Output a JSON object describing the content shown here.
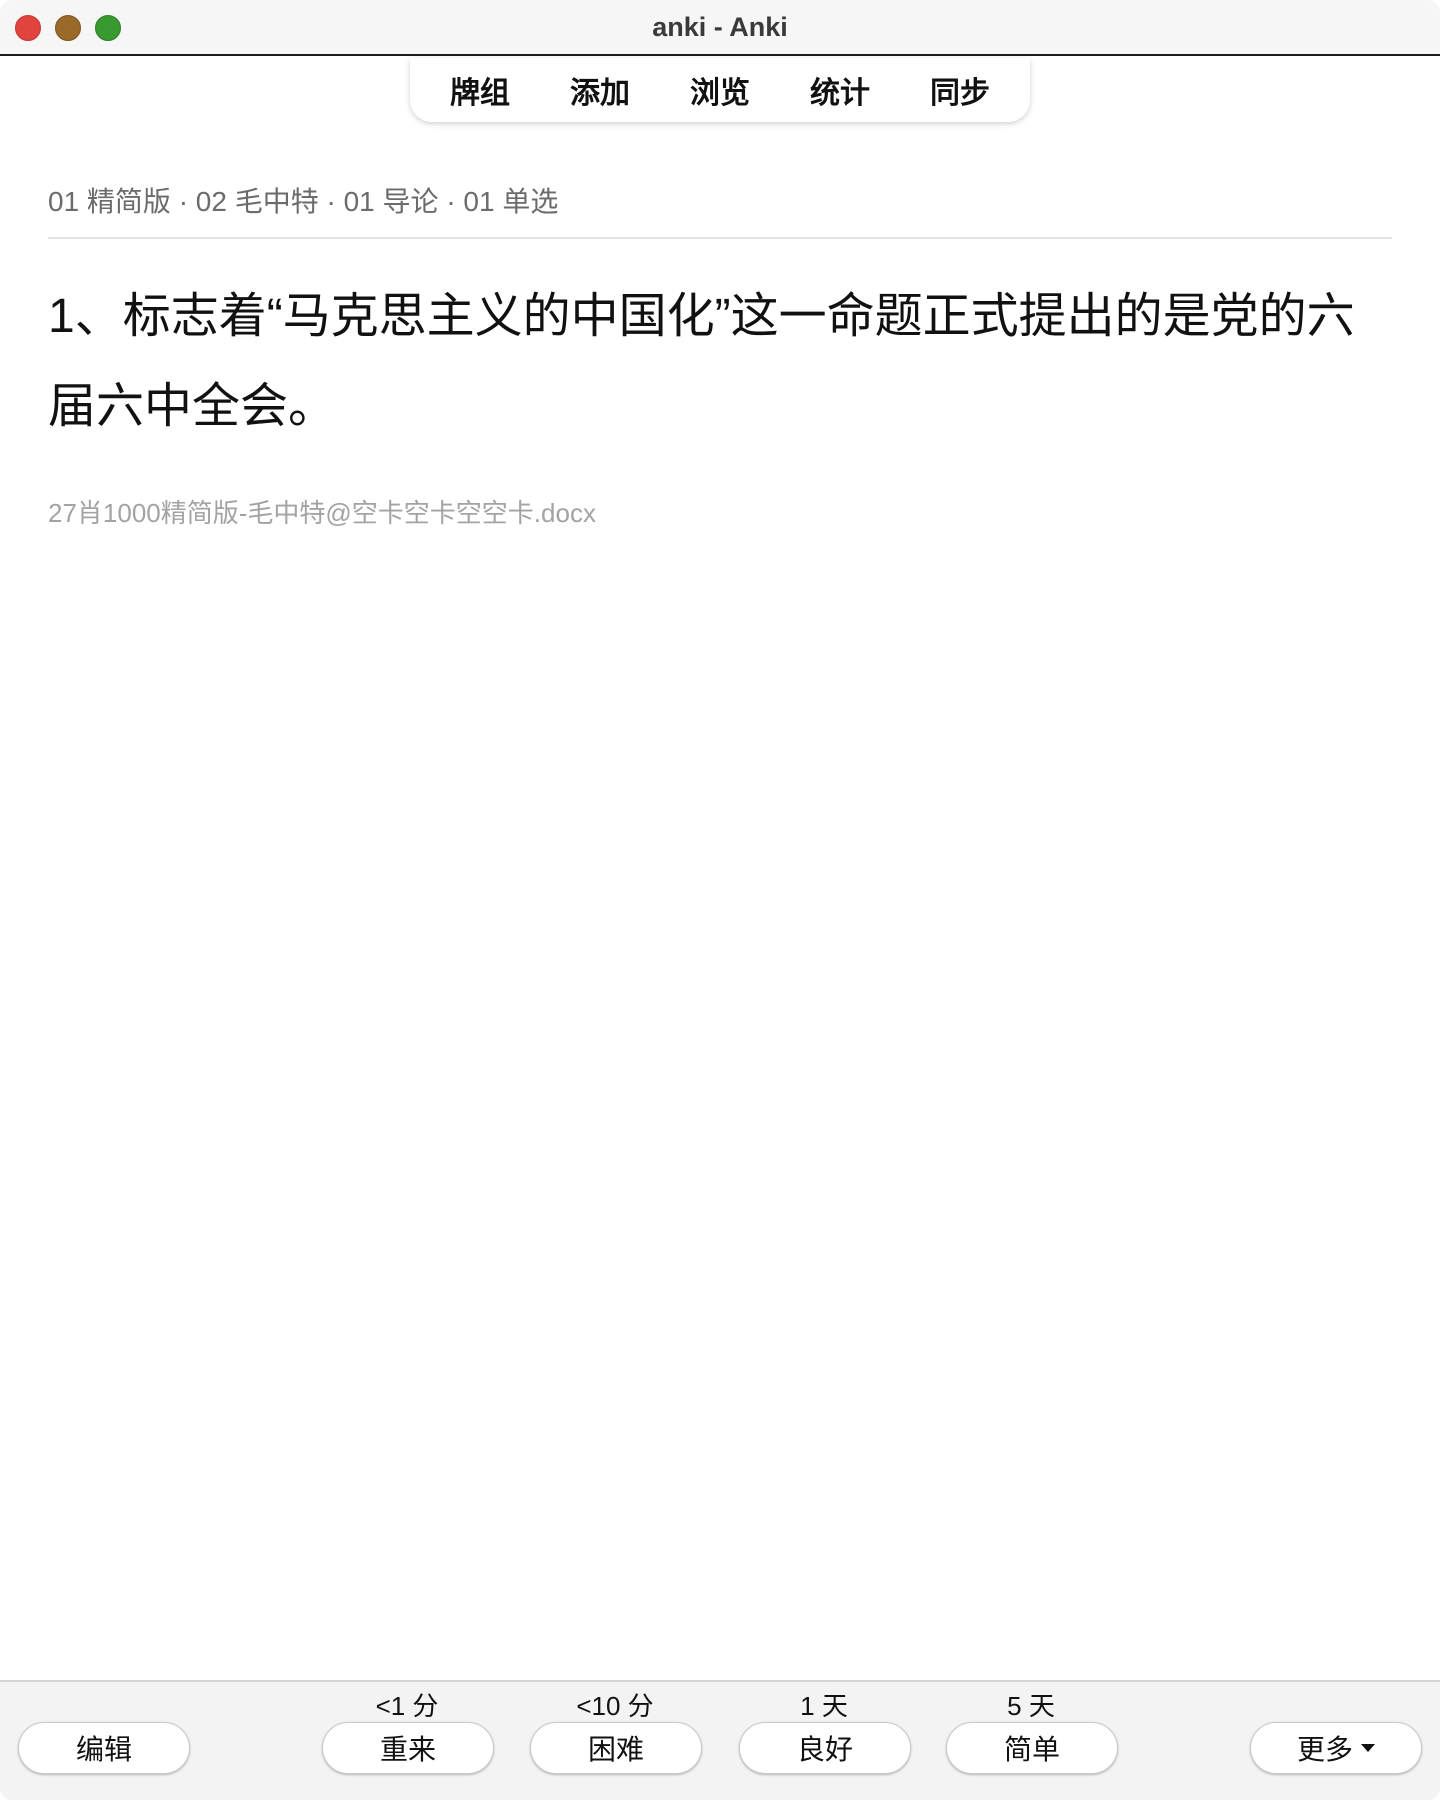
{
  "window": {
    "title": "anki - Anki"
  },
  "toolbar": {
    "items": [
      {
        "label": "牌组"
      },
      {
        "label": "添加"
      },
      {
        "label": "浏览"
      },
      {
        "label": "统计"
      },
      {
        "label": "同步"
      }
    ]
  },
  "card": {
    "deck_path": "01 精简版 · 02 毛中特 · 01 导论 · 01 单选",
    "question": "1、标志着“马克思主义的中国化”这一命题正式提出的是党的六届六中全会。",
    "source": "27肖1000精简版-毛中特@空卡空卡空空卡.docx"
  },
  "bottom_bar": {
    "edit_label": "编辑",
    "more_label": "更多",
    "answers": [
      {
        "label": "重来",
        "interval": "<1 分"
      },
      {
        "label": "困难",
        "interval": "<10 分"
      },
      {
        "label": "良好",
        "interval": "1 天"
      },
      {
        "label": "简单",
        "interval": "5 天"
      }
    ]
  },
  "colors": {
    "close": "#e0443e",
    "minimize": "#9a6a2a",
    "maximize": "#3a9a32",
    "deck_path_text": "#6b6b6b",
    "source_text": "#a3a3a3"
  }
}
